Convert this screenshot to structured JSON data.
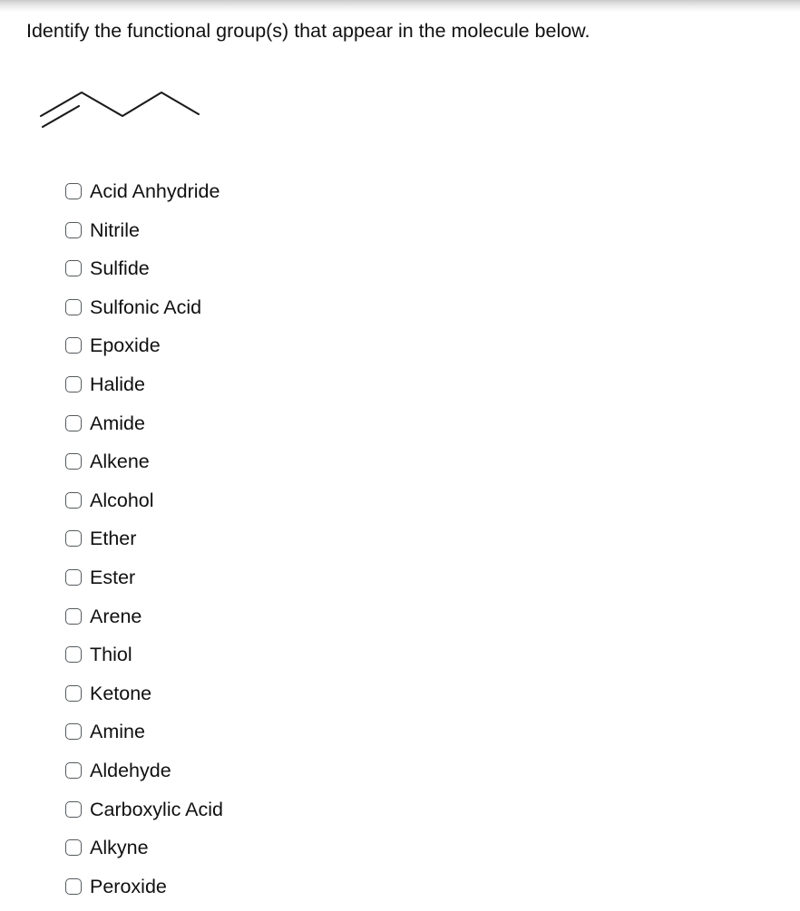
{
  "question": {
    "prompt": "Identify the functional group(s) that appear in the molecule below."
  },
  "molecule": {
    "name": "1-pentene-skeletal-structure",
    "description": "Zigzag skeletal line structure with a terminal carbon-carbon double bond on the left end",
    "line_color": "#1a1a1a"
  },
  "options": [
    {
      "label": "Acid Anhydride",
      "checked": false
    },
    {
      "label": "Nitrile",
      "checked": false
    },
    {
      "label": "Sulfide",
      "checked": false
    },
    {
      "label": "Sulfonic Acid",
      "checked": false
    },
    {
      "label": "Epoxide",
      "checked": false
    },
    {
      "label": "Halide",
      "checked": false
    },
    {
      "label": "Amide",
      "checked": false
    },
    {
      "label": "Alkene",
      "checked": false
    },
    {
      "label": "Alcohol",
      "checked": false
    },
    {
      "label": "Ether",
      "checked": false
    },
    {
      "label": "Ester",
      "checked": false
    },
    {
      "label": "Arene",
      "checked": false
    },
    {
      "label": "Thiol",
      "checked": false
    },
    {
      "label": "Ketone",
      "checked": false
    },
    {
      "label": "Amine",
      "checked": false
    },
    {
      "label": "Aldehyde",
      "checked": false
    },
    {
      "label": "Carboxylic Acid",
      "checked": false
    },
    {
      "label": "Alkyne",
      "checked": false
    },
    {
      "label": "Peroxide",
      "checked": false
    }
  ],
  "colors": {
    "background": "#ffffff",
    "text": "#101010",
    "checkbox_border": "#555a5d",
    "molecule_stroke": "#1a1a1a",
    "top_shade": "#c9c9c9"
  }
}
